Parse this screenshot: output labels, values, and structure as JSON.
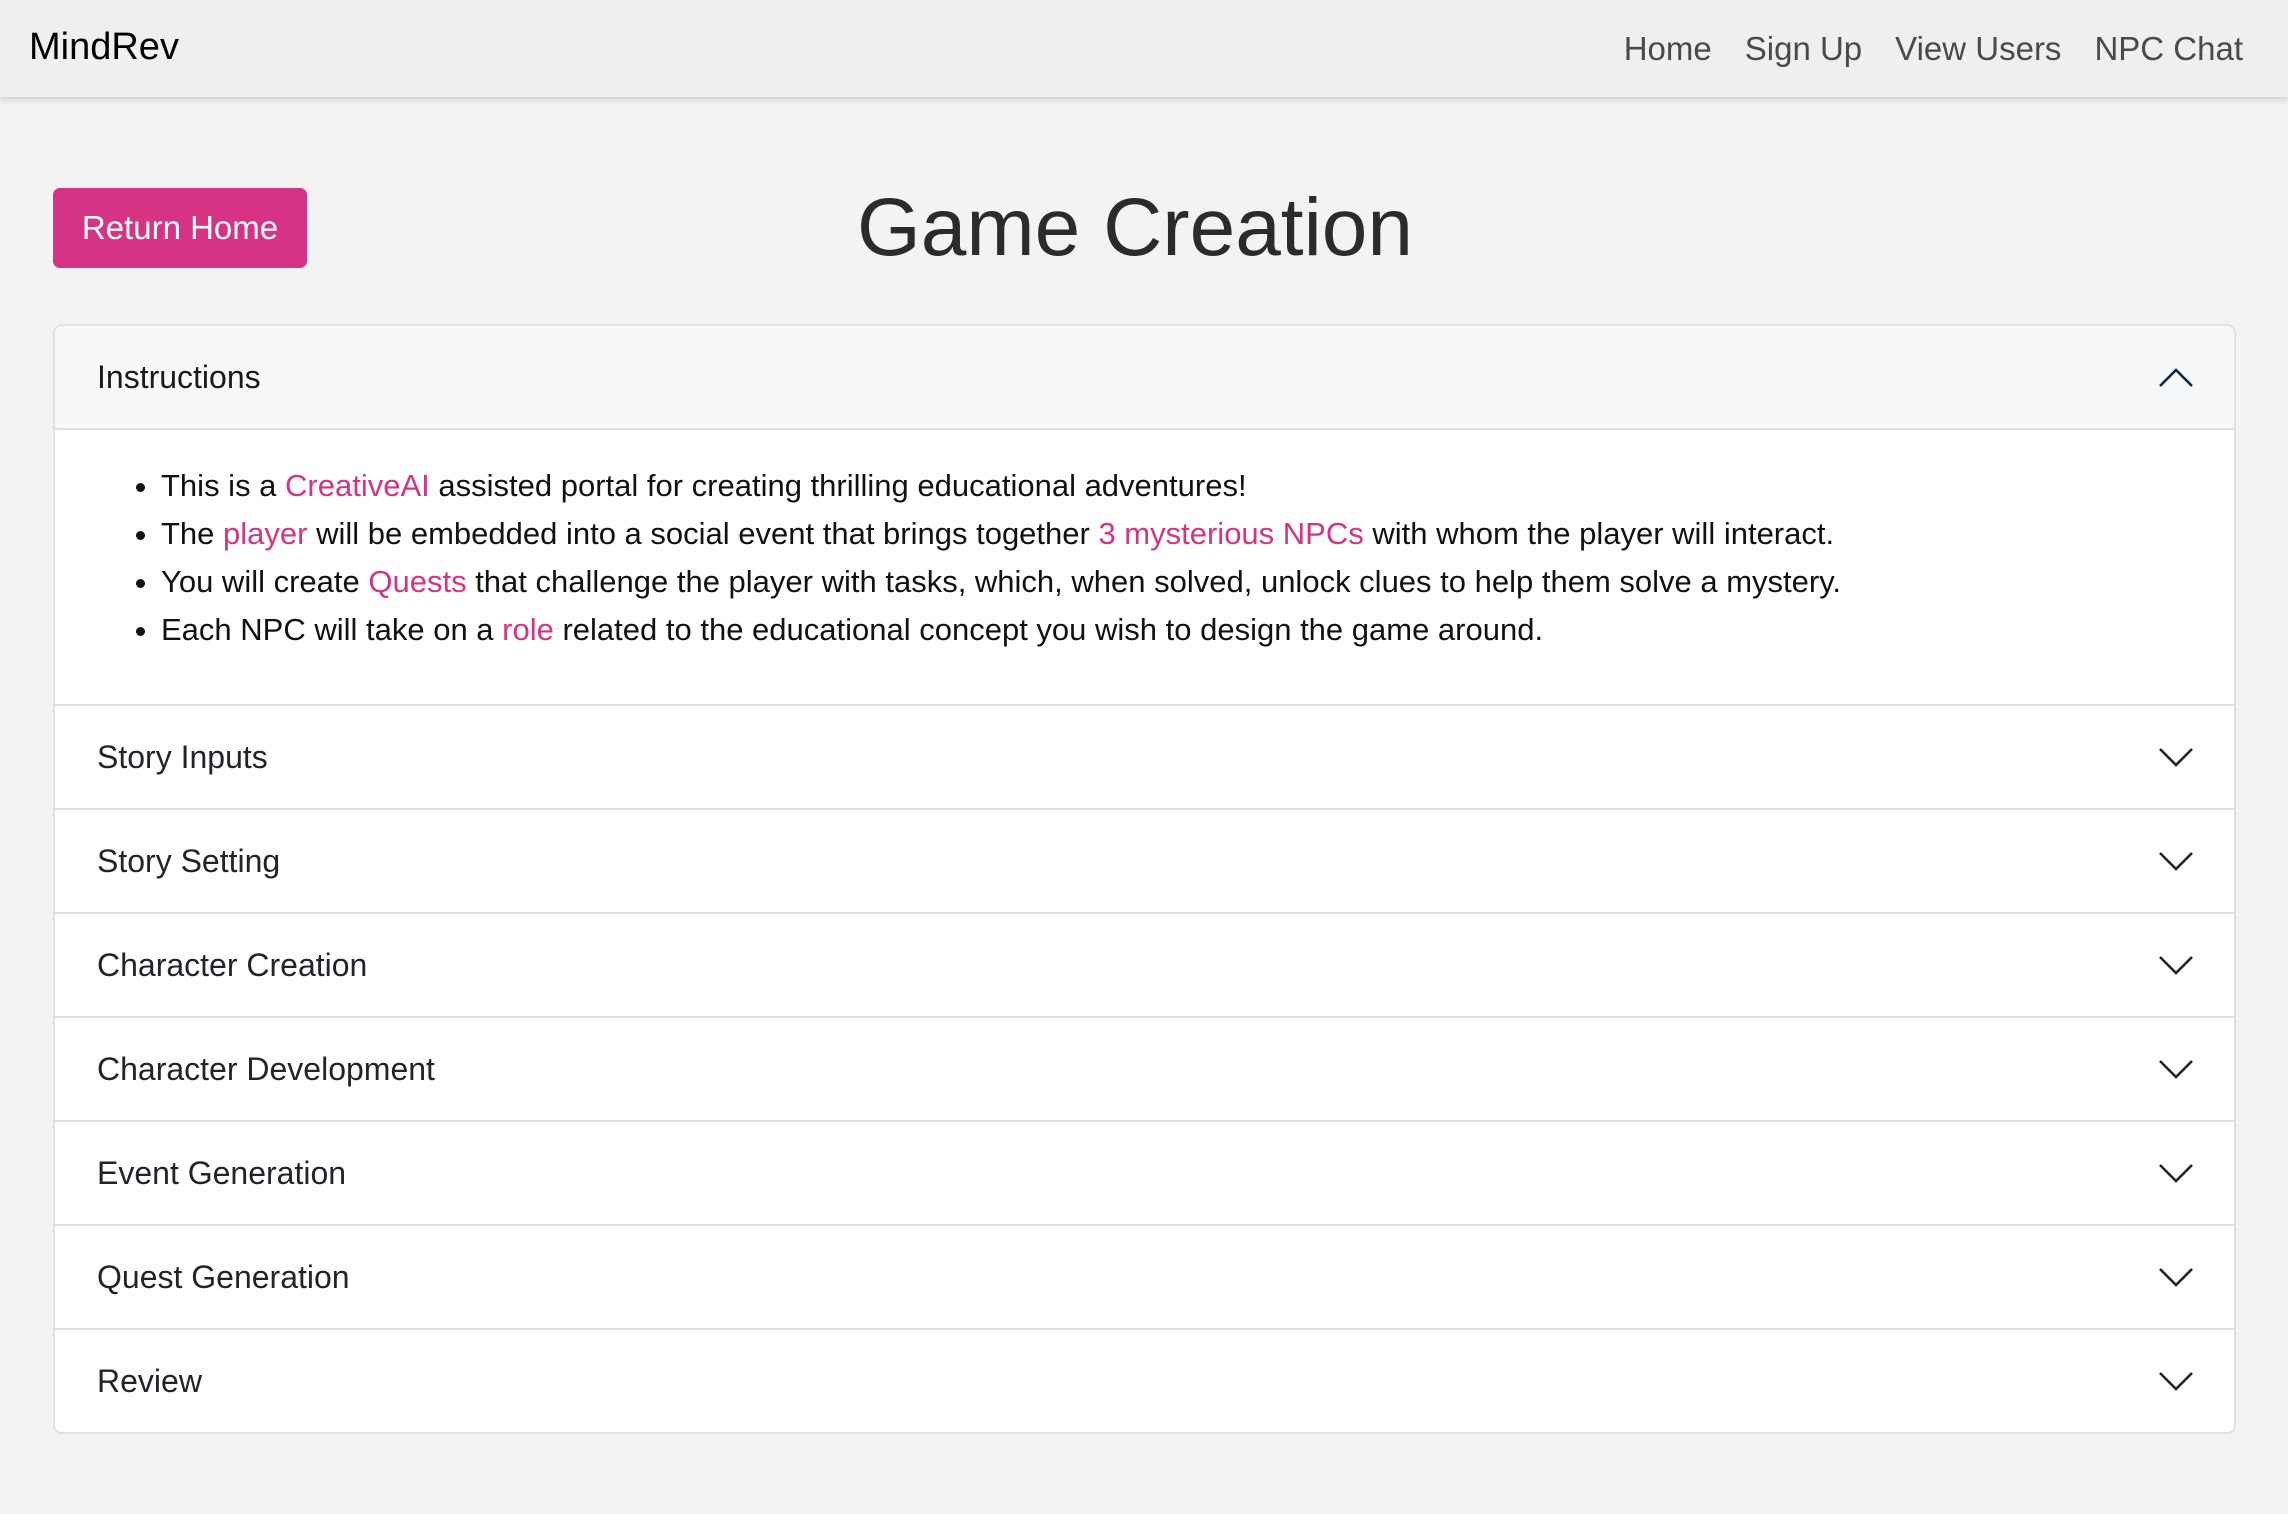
{
  "navbar": {
    "brand": "MindRev",
    "links": [
      "Home",
      "Sign Up",
      "View Users",
      "NPC Chat"
    ]
  },
  "page": {
    "return_button": "Return Home",
    "title": "Game Creation"
  },
  "instructions": {
    "header": "Instructions",
    "expanded": true,
    "bullets": [
      {
        "pre": "This is a ",
        "hl": "CreativeAI",
        "post": " assisted portal for creating thrilling educational adventures!"
      },
      {
        "pre": "The ",
        "hl": "player",
        "mid": " will be embedded into a social event that brings together ",
        "hl2": "3 mysterious NPCs",
        "post": " with whom the player will interact."
      },
      {
        "pre": "You will create ",
        "hl": "Quests",
        "post": " that challenge the player with tasks, which, when solved, unlock clues to help them solve a mystery."
      },
      {
        "pre": "Each NPC will take on a ",
        "hl": "role",
        "post": " related to the educational concept you wish to design the game around."
      }
    ]
  },
  "sections": [
    "Story Inputs",
    "Story Setting",
    "Character Creation",
    "Character Development",
    "Event Generation",
    "Quest Generation",
    "Review"
  ],
  "colors": {
    "accent": "#d63384",
    "background": "#f3f3f3",
    "navbar": "#efefef"
  },
  "icons": {
    "expanded": "chevron-up-icon",
    "collapsed": "chevron-down-icon"
  }
}
